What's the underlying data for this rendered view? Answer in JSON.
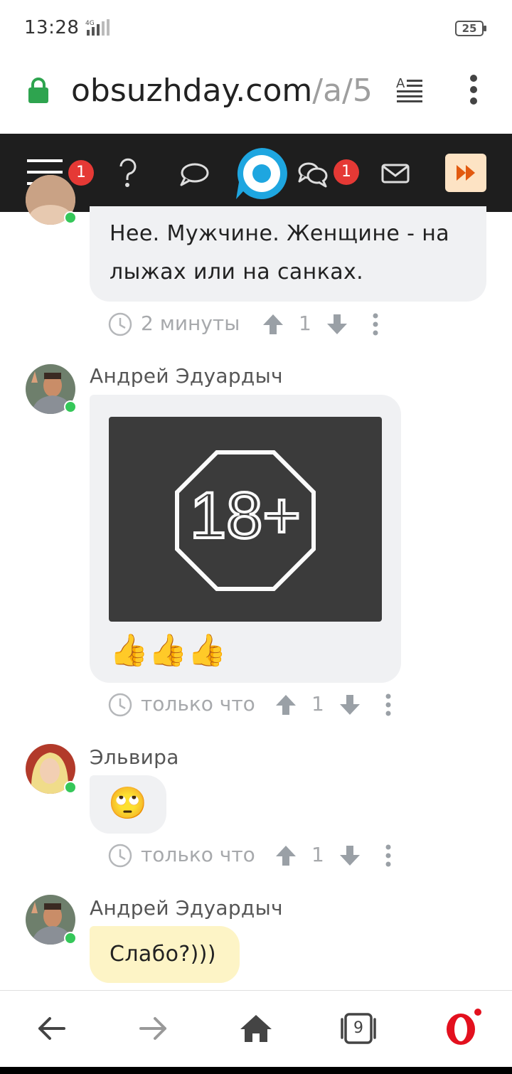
{
  "status_bar": {
    "time": "13:28",
    "network": "4G",
    "battery": "25"
  },
  "browser": {
    "url_host": "obsuzhday.com",
    "url_path": "/a/5",
    "tabs_count": "9"
  },
  "nav": {
    "menu_badge": "1",
    "messages_badge": "1"
  },
  "comments": [
    {
      "text": "Нее. Мужчине. Женщине - на лыжах или на санках.",
      "time": "2 минуты",
      "score": "1"
    },
    {
      "author": "Андрей Эдуардыч",
      "image_label": "18+",
      "emoji": "👍👍👍",
      "time": "только что",
      "score": "1"
    },
    {
      "author": "Эльвира",
      "emoji": "🙄",
      "time": "только что",
      "score": "1"
    },
    {
      "author": "Андрей Эдуардыч",
      "text": "Слабо?)))"
    }
  ],
  "colors": {
    "nav_bg": "#1e1e1e",
    "badge": "#e53935",
    "brand_blue": "#1ea6e0",
    "lock_green": "#2ea44f",
    "bubble_gray": "#f0f1f3",
    "bubble_yellow": "#fdf4c6",
    "opera_red": "#e3101e"
  },
  "icons": [
    "lock-icon",
    "reader-mode-icon",
    "menu-icon",
    "help-icon",
    "chat-icon",
    "logo-icon",
    "messages-icon",
    "mail-icon",
    "fast-forward-icon",
    "clock-icon",
    "upvote-icon",
    "downvote-icon",
    "more-icon",
    "back-icon",
    "forward-icon",
    "home-icon",
    "tabs-icon",
    "opera-icon"
  ]
}
